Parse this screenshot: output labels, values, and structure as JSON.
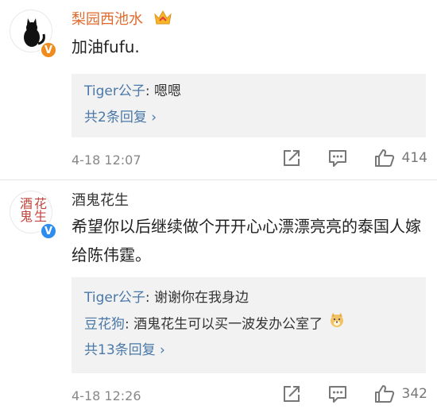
{
  "comments": [
    {
      "username": "梨园西池水",
      "text": "加油fufu.",
      "replies": [
        {
          "name": "Tiger公子",
          "sep": ": ",
          "text": "嗯嗯"
        }
      ],
      "more_replies": "共2条回复 ›",
      "time": "4-18 12:07",
      "likes": "414",
      "colors": {
        "username": "#e06a2c",
        "badge": "#f08c1e"
      }
    },
    {
      "username": "酒鬼花生",
      "text": "希望你以后继续做个开开心心漂漂亮亮的泰国人嫁给陈伟霆。",
      "avatar_text": "酒鬼花生",
      "replies": [
        {
          "name": "Tiger公子",
          "sep": ": ",
          "text": "谢谢你在我身边"
        },
        {
          "name": "豆花狗",
          "sep": ": ",
          "text": "酒鬼花生可以买一波发办公室了"
        }
      ],
      "more_replies": "共13条回复 ›",
      "time": "4-18 12:26",
      "likes": "342",
      "colors": {
        "username": "#333333",
        "badge": "#2d8cf0"
      }
    }
  ]
}
